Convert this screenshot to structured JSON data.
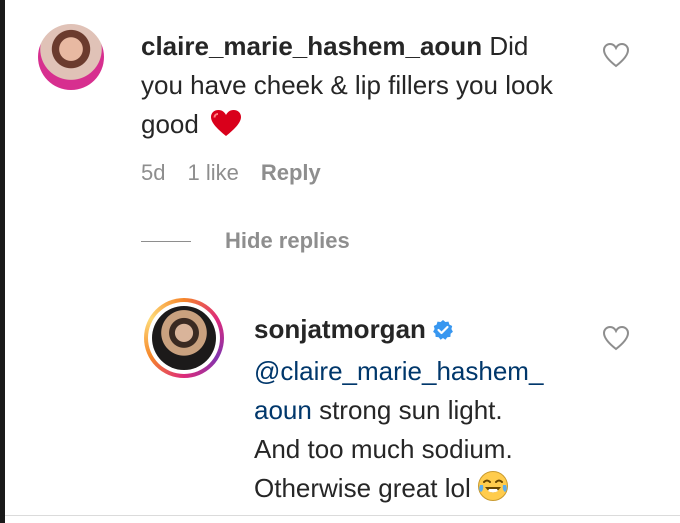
{
  "comment": {
    "username": "claire_marie_hashem_aoun",
    "text": "Did you have cheek & lip fillers you look good",
    "emoji": "red-heart",
    "age": "5d",
    "likes": "1 like",
    "reply_label": "Reply"
  },
  "replies_toggle": {
    "label": "Hide replies"
  },
  "reply": {
    "username": "sonjatmorgan",
    "verified": true,
    "mention_line1": "@claire_marie_hashem_",
    "mention_line2": "aoun",
    "text_line1": "strong sun light.",
    "text_line2": "And too much sodium.",
    "text_line3": "Otherwise great lol",
    "emoji": "face-with-tears-of-joy"
  },
  "colors": {
    "text": "#262626",
    "muted": "#8e8e8e",
    "mention": "#00376b",
    "heart": "#ed4956",
    "verified": "#3897f0"
  }
}
